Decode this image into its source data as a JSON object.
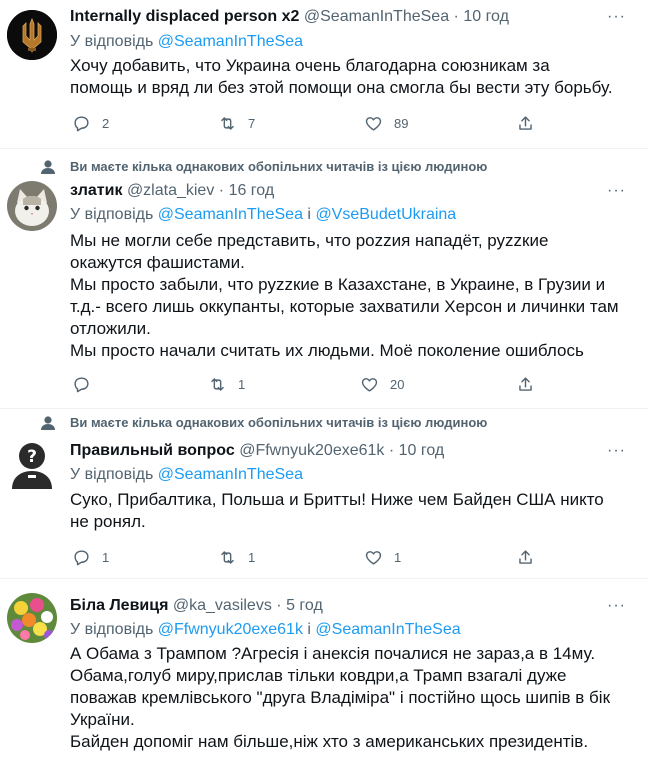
{
  "tweets": [
    {
      "name": "Internally displaced person x2",
      "handle": "@SeamanInTheSea",
      "time": "10 год",
      "reply_prefix": "У відповідь",
      "reply_to": [
        "@SeamanInTheSea"
      ],
      "lines": [
        "Хочу добавить,  что Украина очень благодарна союзникам за",
        "помощь и вряд ли без этой помощи она смогла бы вести эту борьбу."
      ],
      "replies": "2",
      "retweets": "7",
      "likes": "89"
    },
    {
      "social": "Ви маєте кілька однакових обопільних читачів із цією людиною",
      "name": "златик",
      "handle": "@zlata_kiev",
      "time": "16 год",
      "reply_prefix": "У відповідь",
      "reply_to": [
        "@SeamanInTheSea",
        "@VseBudetUkraina"
      ],
      "reply_joiner": "і",
      "lines": [
        "Мы не могли себе представить, что роzzия нападёт, руzzкие",
        "окажутся фашистами.",
        "Мы просто забыли, что руzzкие в Казахстане, в Украине, в Грузии и",
        "т.д.- всего лишь оккупанты, которые захватили Херсон и личинки там",
        "отложили.",
        "Мы просто начали считать их людьми. Моё поколение ошиблось"
      ],
      "replies": "",
      "retweets": "1",
      "likes": "20"
    },
    {
      "social": "Ви маєте кілька однакових обопільних читачів із цією людиною",
      "name": "Правильный вопрос",
      "handle": "@Ffwnyuk20exe61k",
      "time": "10 год",
      "reply_prefix": "У відповідь",
      "reply_to": [
        "@SeamanInTheSea"
      ],
      "lines": [
        "Суко, Прибалтика, Польша и Бритты! Ниже чем Байден США никто",
        "не ронял."
      ],
      "replies": "1",
      "retweets": "1",
      "likes": "1"
    },
    {
      "name": "Біла Левиця",
      "handle": "@ka_vasilevs",
      "time": "5 год",
      "reply_prefix": "У відповідь",
      "reply_to": [
        "@Ffwnyuk20exe61k",
        "@SeamanInTheSea"
      ],
      "reply_joiner": "і",
      "lines": [
        "А Обама з Трампом ?Агресія і анексія почалися не зараз,а в 14му.",
        "Обама,голуб миру,прислав тільки ковдри,а Трамп взагалі дуже",
        "поважав кремлівського \"друга Владіміра\" і постійно щось шипів в бік",
        "України.",
        "Байден допоміг нам більше,ніж хто з американських президентів."
      ]
    }
  ],
  "header_separator": "·",
  "more_glyph": "···",
  "colors": {
    "link": "#1d9bf0",
    "secondary": "#536471",
    "text": "#0f1419",
    "divider": "#eff3f4"
  }
}
